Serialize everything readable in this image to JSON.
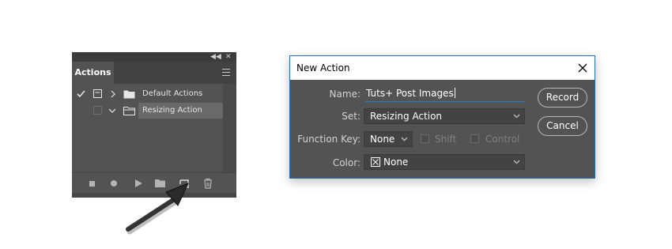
{
  "actions_panel": {
    "tab_label": "Actions",
    "rows": [
      {
        "label": "Default Actions",
        "checked": true,
        "expanded": false,
        "selected": false
      },
      {
        "label": "Resizing Action",
        "checked": false,
        "expanded": true,
        "selected": true
      }
    ],
    "bottom_buttons": [
      "stop-icon",
      "record-icon",
      "play-icon",
      "new-set-icon",
      "new-action-icon",
      "delete-icon"
    ]
  },
  "dialog": {
    "title": "New Action",
    "name_label": "Name:",
    "name_value": "Tuts+ Post Images",
    "set_label": "Set:",
    "set_value": "Resizing Action",
    "function_key_label": "Function Key:",
    "function_key_value": "None",
    "shift_label": "Shift",
    "control_label": "Control",
    "color_label": "Color:",
    "color_value": "None",
    "record_button": "Record",
    "cancel_button": "Cancel"
  },
  "colors": {
    "panel_bg": "#535353",
    "accent_blue": "#2f78c8",
    "selected_row": "#696969"
  }
}
